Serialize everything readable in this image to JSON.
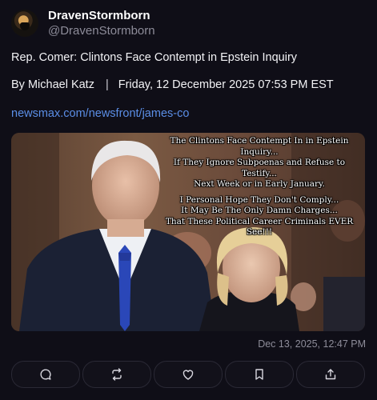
{
  "author": {
    "display_name": "DravenStormborn",
    "handle": "@DravenStormborn"
  },
  "post": {
    "headline": "Rep. Comer: Clintons Face Contempt in Epstein Inquiry",
    "byline_author": "By Michael Katz",
    "byline_separator": "|",
    "byline_date": "Friday, 12 December 2025 07:53 PM EST",
    "link_text": "newsmax.com/newsfront/james-co",
    "image_caption_lines_1": [
      "The Clintons Face Contempt In in Epstein Inquiry...",
      "If They Ignore Subpoenas and Refuse to Testify...",
      "Next Week or in Early January."
    ],
    "image_caption_lines_2": [
      "I Personal Hope They Don't Comply...",
      "It May Be The Only Damn Charges...",
      "That These Political Career Criminals EVER See!!!"
    ],
    "timestamp": "Dec 13, 2025, 12:47 PM"
  },
  "actions": [
    {
      "name": "reply-button",
      "icon": "reply-icon"
    },
    {
      "name": "repost-button",
      "icon": "repost-icon"
    },
    {
      "name": "like-button",
      "icon": "heart-icon"
    },
    {
      "name": "bookmark-button",
      "icon": "bookmark-icon"
    },
    {
      "name": "share-button",
      "icon": "share-icon"
    }
  ],
  "colors": {
    "background": "#0f0e17",
    "link": "#5b8ee6",
    "muted": "#8d8c99"
  }
}
